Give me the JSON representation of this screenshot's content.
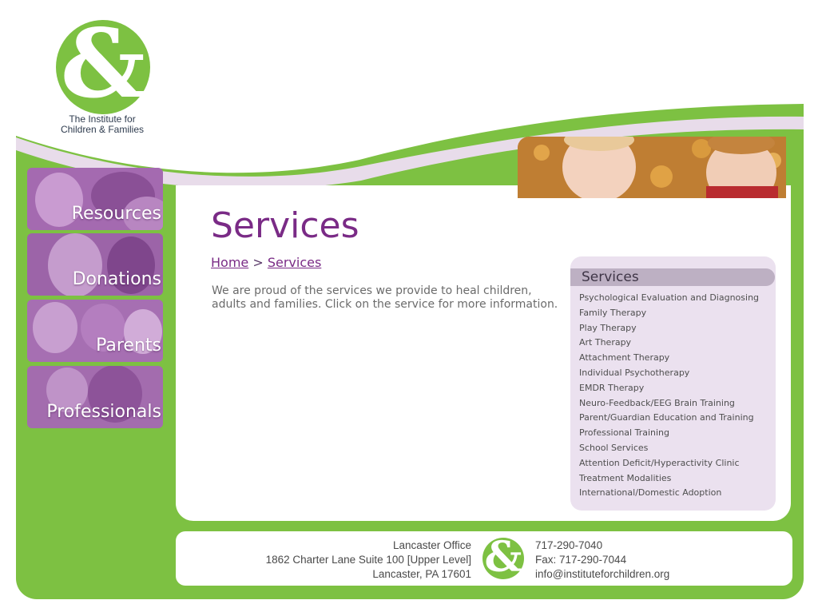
{
  "brand": {
    "logo_text_line1": "The Institute for",
    "logo_text_line2": "Children & Families",
    "logo_glyph": "&",
    "green": "#7dc142",
    "purple": "#7a2b86"
  },
  "nav": [
    {
      "label": "Resources",
      "photo": "children-photo"
    },
    {
      "label": "Donations",
      "photo": "smiling-people-photo"
    },
    {
      "label": "Parents",
      "photo": "family-photo"
    },
    {
      "label": "Professionals",
      "photo": "mother-child-photo"
    }
  ],
  "header_photo": "children-in-autumn-leaves-photo",
  "page": {
    "title": "Services",
    "breadcrumb_home": "Home",
    "breadcrumb_sep": ">",
    "breadcrumb_current": "Services",
    "intro_line1": "We are proud of the services we provide to heal children,",
    "intro_line2": "adults and families. Click on the service for more information."
  },
  "services_box": {
    "title": "Services",
    "items": [
      "Psychological Evaluation and Diagnosing",
      "Family Therapy",
      "Play Therapy",
      "Art Therapy",
      "Attachment Therapy",
      "Individual Psychotherapy",
      "EMDR Therapy",
      "Neuro-Feedback/EEG Brain Training",
      "Parent/Guardian Education and Training",
      "Professional Training",
      "School Services",
      "Attention Deficit/Hyperactivity Clinic",
      "Treatment Modalities",
      "International/Domestic Adoption"
    ]
  },
  "footer": {
    "office_name": "Lancaster Office",
    "address": "1862 Charter Lane Suite 100 [Upper Level]",
    "city": "Lancaster, PA 17601",
    "phone": "717-290-7040",
    "fax": "Fax: 717-290-7044",
    "email": "info@instituteforchildren.org"
  }
}
